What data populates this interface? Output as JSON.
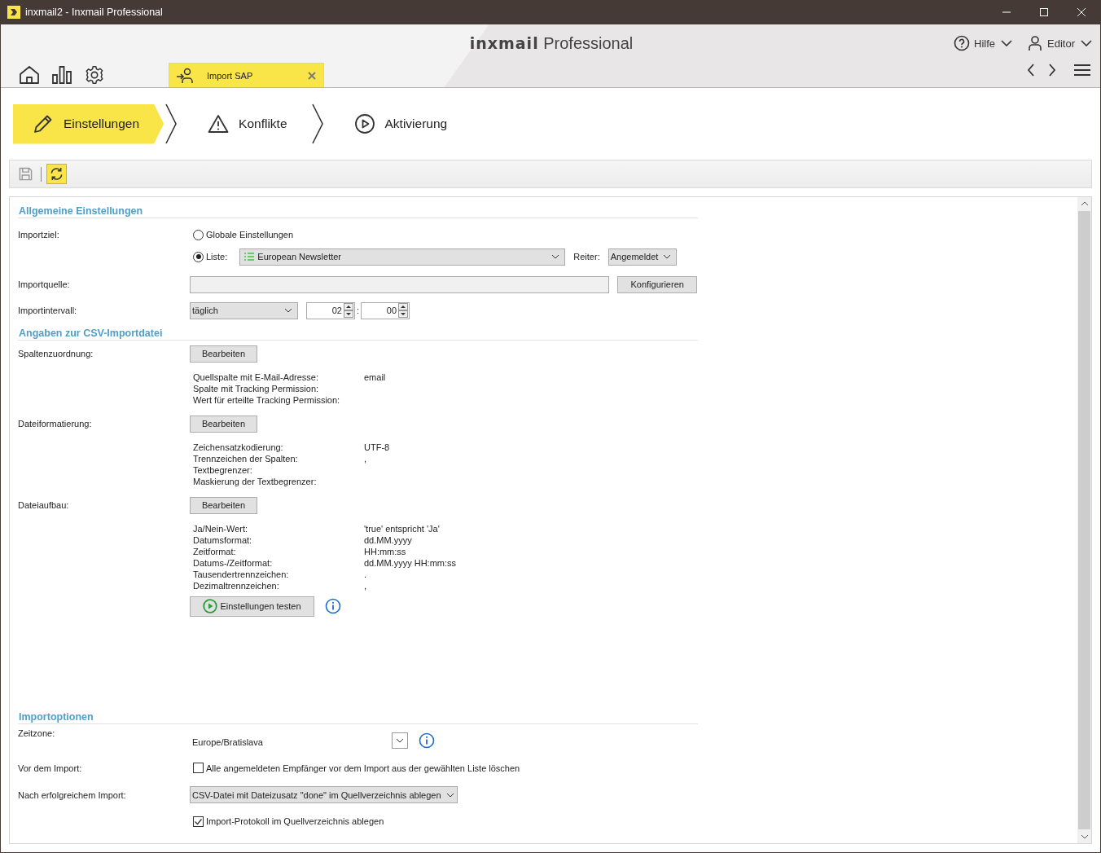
{
  "window": {
    "title": "inxmail2 - Inxmail Professional"
  },
  "header": {
    "logo_brand": "inxmail",
    "logo_product": "Professional",
    "help_menu": "Hilfe",
    "user_menu": "Editor"
  },
  "tabs": [
    {
      "label": "Import SAP",
      "selected": true
    }
  ],
  "steps": [
    {
      "label": "Einstellungen",
      "kind": "edit",
      "selected": true
    },
    {
      "label": "Konflikte",
      "kind": "warning",
      "selected": false
    },
    {
      "label": "Aktivierung",
      "kind": "play",
      "selected": false
    }
  ],
  "toolbar": [
    {
      "kind": "save",
      "active": false
    },
    {
      "kind": "refresh",
      "active": true
    }
  ],
  "general": {
    "title": "Allgemeine Einstellungen",
    "import_target": {
      "label": "Importziel:",
      "options": [
        {
          "label": "Globale Einstellungen",
          "selected": false
        },
        {
          "label": "Liste:",
          "selected": true
        }
      ],
      "list": "European Newsletter",
      "tab_label": "Reiter:",
      "tab_value": "Angemeldet"
    },
    "import_source": {
      "label": "Importquelle:",
      "button": "Konfigurieren"
    },
    "interval": {
      "label": "Importintervall:",
      "value": "täglich",
      "hour": "02",
      "separator": ":",
      "minute": "00"
    }
  },
  "csv": {
    "title": "Angaben zur CSV-Importdatei",
    "groups": [
      {
        "label": "Spaltenzuordnung:",
        "button": "Bearbeiten",
        "rows": [
          {
            "key": "Quellspalte mit E-Mail-Adresse:",
            "value": "email"
          },
          {
            "key": "Spalte mit Tracking Permission:"
          },
          {
            "key": "Wert für erteilte Tracking Permission:"
          }
        ]
      },
      {
        "label": "Dateiformatierung:",
        "button": "Bearbeiten",
        "rows": [
          {
            "key": "Zeichensatzkodierung:",
            "value": "UTF-8"
          },
          {
            "key": "Trennzeichen der Spalten:",
            "value": ","
          },
          {
            "key": "Textbegrenzer:"
          },
          {
            "key": "Maskierung der Textbegrenzer:"
          }
        ]
      },
      {
        "label": "Dateiaufbau:",
        "button": "Bearbeiten",
        "rows": [
          {
            "key": "Ja/Nein-Wert:",
            "value": "'true' entspricht 'Ja'"
          },
          {
            "key": "Datumsformat:",
            "value": "dd.MM.yyyy"
          },
          {
            "key": "Zeitformat:",
            "value": "HH:mm:ss"
          },
          {
            "key": "Datums-/Zeitformat:",
            "value": "dd.MM.yyyy HH:mm:ss"
          },
          {
            "key": "Tausendertrennzeichen:",
            "value": "."
          },
          {
            "key": "Dezimaltrennzeichen:",
            "value": ","
          }
        ]
      }
    ],
    "test_button": "Einstellungen testen"
  },
  "options": {
    "title": "Importoptionen",
    "timezone": {
      "label": "Zeitzone:",
      "value": "Europe/Bratislava"
    },
    "before": {
      "label": "Vor dem Import:",
      "checkbox": {
        "label": "Alle angemeldeten Empfänger vor dem Import aus der gewählten Liste löschen",
        "checked": false
      }
    },
    "after": {
      "label": "Nach erfolgreichem Import:",
      "value": "CSV-Datei mit Dateizusatz \"done\" im Quellverzeichnis ablegen",
      "checkbox": {
        "label": "Import-Protokoll im Quellverzeichnis ablegen",
        "checked": true
      }
    }
  }
}
